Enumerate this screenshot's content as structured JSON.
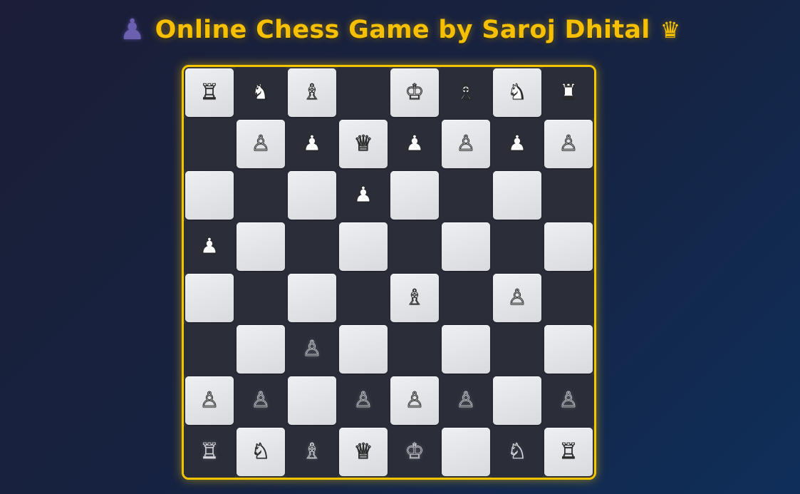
{
  "header": {
    "pawn_glyph": "♟",
    "title": "Online Chess Game by Saroj Dhital",
    "crown_glyph": "♛"
  },
  "board": {
    "rows": [
      [
        {
          "square": "a8",
          "glyph": "♖",
          "color": "white"
        },
        {
          "square": "b8",
          "glyph": "♞",
          "color": "white"
        },
        {
          "square": "c8",
          "glyph": "♗",
          "color": "white"
        },
        {
          "square": "d8",
          "glyph": "",
          "color": ""
        },
        {
          "square": "e8",
          "glyph": "♔",
          "color": "white"
        },
        {
          "square": "f8",
          "glyph": "♗",
          "color": "white"
        },
        {
          "square": "g8",
          "glyph": "♞",
          "color": "white"
        },
        {
          "square": "h8",
          "glyph": "♜",
          "color": "white"
        }
      ],
      [
        {
          "square": "a7",
          "glyph": "",
          "color": ""
        },
        {
          "square": "b7",
          "glyph": "♙",
          "color": "white"
        },
        {
          "square": "c7",
          "glyph": "♟",
          "color": "white"
        },
        {
          "square": "d7",
          "glyph": "♕",
          "color": "white"
        },
        {
          "square": "e7",
          "glyph": "♟",
          "color": "white"
        },
        {
          "square": "f7",
          "glyph": "♙",
          "color": "white"
        },
        {
          "square": "g7",
          "glyph": "♟",
          "color": "white"
        },
        {
          "square": "h7",
          "glyph": "♙",
          "color": "white"
        }
      ],
      [
        {
          "square": "a6",
          "glyph": "",
          "color": ""
        },
        {
          "square": "b6",
          "glyph": "",
          "color": ""
        },
        {
          "square": "c6",
          "glyph": "",
          "color": ""
        },
        {
          "square": "d6",
          "glyph": "♟",
          "color": "white"
        },
        {
          "square": "e6",
          "glyph": "",
          "color": ""
        },
        {
          "square": "f6",
          "glyph": "",
          "color": ""
        },
        {
          "square": "g6",
          "glyph": "",
          "color": ""
        },
        {
          "square": "h6",
          "glyph": "",
          "color": ""
        }
      ],
      [
        {
          "square": "a5",
          "glyph": "♟",
          "color": "white"
        },
        {
          "square": "b5",
          "glyph": "",
          "color": ""
        },
        {
          "square": "c5",
          "glyph": "",
          "color": ""
        },
        {
          "square": "d5",
          "glyph": "",
          "color": ""
        },
        {
          "square": "e5",
          "glyph": "",
          "color": ""
        },
        {
          "square": "f5",
          "glyph": "",
          "color": ""
        },
        {
          "square": "g5",
          "glyph": "",
          "color": ""
        },
        {
          "square": "h5",
          "glyph": "",
          "color": ""
        }
      ],
      [
        {
          "square": "a4",
          "glyph": "",
          "color": ""
        },
        {
          "square": "b4",
          "glyph": "",
          "color": ""
        },
        {
          "square": "c4",
          "glyph": "",
          "color": ""
        },
        {
          "square": "d4",
          "glyph": "",
          "color": ""
        },
        {
          "square": "e4",
          "glyph": "♗",
          "color": "black"
        },
        {
          "square": "f4",
          "glyph": "",
          "color": ""
        },
        {
          "square": "g4",
          "glyph": "♙",
          "color": "black"
        },
        {
          "square": "h4",
          "glyph": "",
          "color": ""
        }
      ],
      [
        {
          "square": "a3",
          "glyph": "",
          "color": ""
        },
        {
          "square": "b3",
          "glyph": "",
          "color": ""
        },
        {
          "square": "c3",
          "glyph": "♙",
          "color": "black"
        },
        {
          "square": "d3",
          "glyph": "",
          "color": ""
        },
        {
          "square": "e3",
          "glyph": "",
          "color": ""
        },
        {
          "square": "f3",
          "glyph": "",
          "color": ""
        },
        {
          "square": "g3",
          "glyph": "",
          "color": ""
        },
        {
          "square": "h3",
          "glyph": "",
          "color": ""
        }
      ],
      [
        {
          "square": "a2",
          "glyph": "♙",
          "color": "black"
        },
        {
          "square": "b2",
          "glyph": "♙",
          "color": "black"
        },
        {
          "square": "c2",
          "glyph": "",
          "color": ""
        },
        {
          "square": "d2",
          "glyph": "♙",
          "color": "black"
        },
        {
          "square": "e2",
          "glyph": "♙",
          "color": "black"
        },
        {
          "square": "f2",
          "glyph": "♙",
          "color": "black"
        },
        {
          "square": "g2",
          "glyph": "",
          "color": ""
        },
        {
          "square": "h2",
          "glyph": "♙",
          "color": "black"
        }
      ],
      [
        {
          "square": "a1",
          "glyph": "♖",
          "color": "black"
        },
        {
          "square": "b1",
          "glyph": "♘",
          "color": "black"
        },
        {
          "square": "c1",
          "glyph": "♗",
          "color": "black"
        },
        {
          "square": "d1",
          "glyph": "♕",
          "color": "black"
        },
        {
          "square": "e1",
          "glyph": "♔",
          "color": "black"
        },
        {
          "square": "f1",
          "glyph": "",
          "color": ""
        },
        {
          "square": "g1",
          "glyph": "♘",
          "color": "black"
        },
        {
          "square": "h1",
          "glyph": "♖",
          "color": "black"
        }
      ]
    ]
  },
  "colors": {
    "accent": "#f2c500",
    "light_square": "#e4e5e8",
    "dark_square": "#2b2e39",
    "background_start": "#1b1e36",
    "background_end": "#0f2f5a"
  }
}
